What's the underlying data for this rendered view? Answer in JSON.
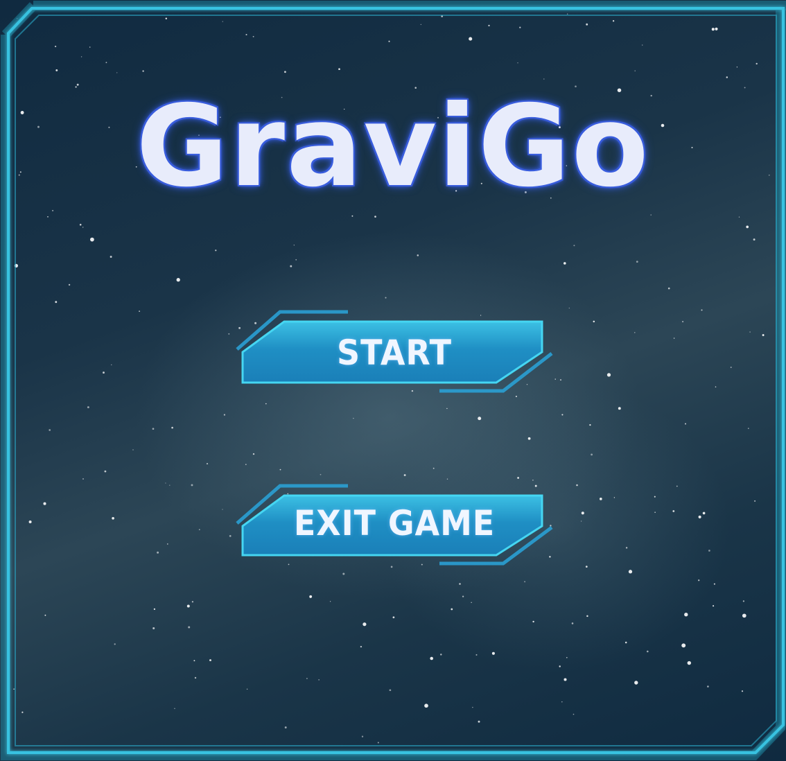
{
  "game": {
    "title": "GraviGo"
  },
  "menu": {
    "start_label": "START",
    "exit_label": "EXIT GAME"
  },
  "colors": {
    "frame": "#2aa6c4",
    "button_fill": "#1f8fc4",
    "button_edge": "#3fd0ee",
    "title_glow": "#3a5fe0",
    "background": "#1a3448"
  }
}
